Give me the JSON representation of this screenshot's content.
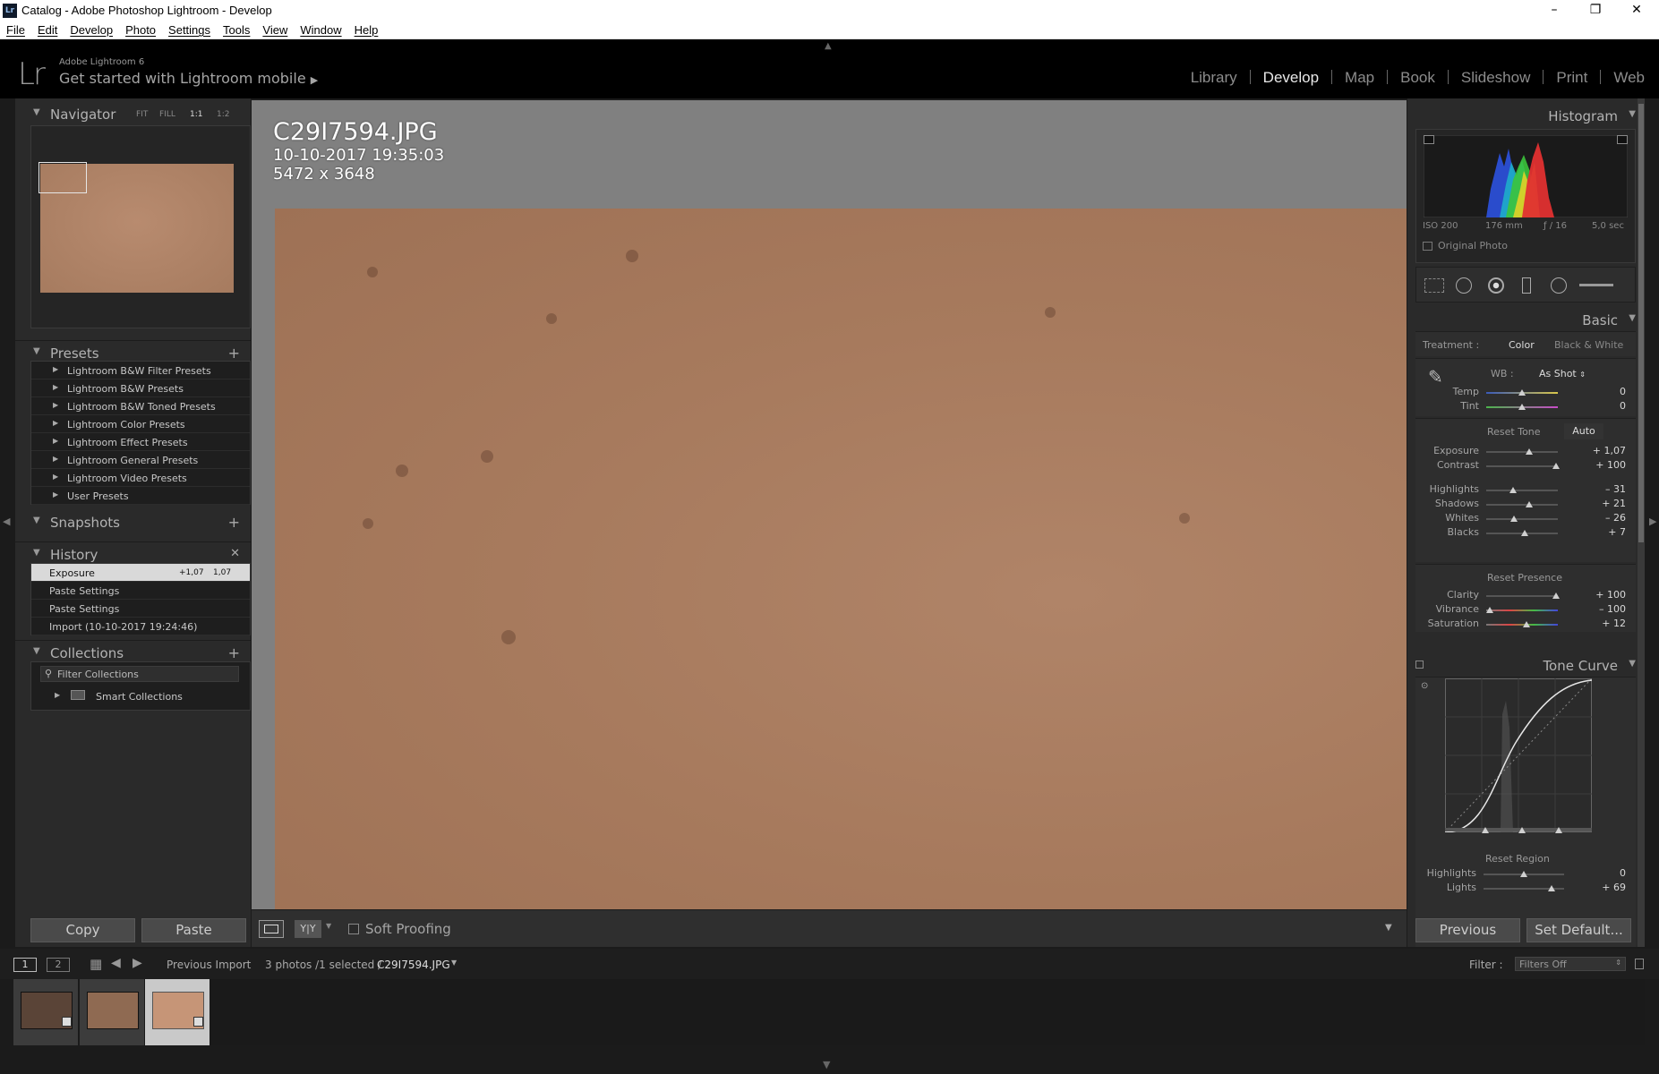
{
  "window": {
    "title": "Catalog - Adobe Photoshop Lightroom - Develop",
    "app_icon": "Lr"
  },
  "menu": [
    "File",
    "Edit",
    "Develop",
    "Photo",
    "Settings",
    "Tools",
    "View",
    "Window",
    "Help"
  ],
  "identity": {
    "version": "Adobe Lightroom 6",
    "mobile": "Get started with Lightroom mobile"
  },
  "modules": [
    "Library",
    "Develop",
    "Map",
    "Book",
    "Slideshow",
    "Print",
    "Web"
  ],
  "active_module": "Develop",
  "navigator": {
    "title": "Navigator",
    "zoom": [
      "FIT",
      "FILL",
      "1:1",
      "1:2"
    ],
    "active_zoom": "1:1"
  },
  "presets": {
    "title": "Presets",
    "items": [
      "Lightroom B&W Filter Presets",
      "Lightroom B&W Presets",
      "Lightroom B&W Toned Presets",
      "Lightroom Color Presets",
      "Lightroom Effect Presets",
      "Lightroom General Presets",
      "Lightroom Video Presets",
      "User Presets"
    ]
  },
  "snapshots": {
    "title": "Snapshots"
  },
  "history": {
    "title": "History",
    "items": [
      {
        "label": "Exposure",
        "v1": "+1,07",
        "v2": "1,07"
      },
      {
        "label": "Paste Settings",
        "v1": "",
        "v2": ""
      },
      {
        "label": "Paste Settings",
        "v1": "",
        "v2": ""
      },
      {
        "label": "Import (10-10-2017 19:24:46)",
        "v1": "",
        "v2": ""
      }
    ]
  },
  "collections": {
    "title": "Collections",
    "filter": "Filter Collections",
    "smart": "Smart Collections"
  },
  "left_buttons": {
    "copy": "Copy",
    "paste": "Paste"
  },
  "image": {
    "name": "C29I7594.JPG",
    "date": "10-10-2017 19:35:03",
    "size": "5472 x 3648"
  },
  "toolbar": {
    "soft_proofing": "Soft Proofing",
    "view_mode": "Y|Y"
  },
  "histogram": {
    "title": "Histogram",
    "iso": "ISO 200",
    "focal": "176 mm",
    "aperture": "ƒ / 16",
    "shutter": "5,0 sec",
    "original_photo": "Original Photo"
  },
  "basic": {
    "title": "Basic",
    "treatment_label": "Treatment :",
    "treatment_color": "Color",
    "treatment_bw": "Black & White",
    "wb_label": "WB :",
    "wb_value": "As Shot",
    "reset_tone": "Reset Tone",
    "auto": "Auto",
    "reset_presence": "Reset Presence",
    "sliders": [
      {
        "label": "Temp",
        "value": "0",
        "pos": 0.5
      },
      {
        "label": "Tint",
        "value": "0",
        "pos": 0.5
      },
      {
        "label": "Exposure",
        "value": "+ 1,07",
        "pos": 0.6
      },
      {
        "label": "Contrast",
        "value": "+ 100",
        "pos": 0.97
      },
      {
        "label": "Highlights",
        "value": "– 31",
        "pos": 0.37
      },
      {
        "label": "Shadows",
        "value": "+ 21",
        "pos": 0.6
      },
      {
        "label": "Whites",
        "value": "– 26",
        "pos": 0.39
      },
      {
        "label": "Blacks",
        "value": "+ 7",
        "pos": 0.54
      },
      {
        "label": "Clarity",
        "value": "+ 100",
        "pos": 0.97
      },
      {
        "label": "Vibrance",
        "value": "– 100",
        "pos": 0.05
      },
      {
        "label": "Saturation",
        "value": "+ 12",
        "pos": 0.56
      }
    ]
  },
  "tone_curve": {
    "title": "Tone Curve",
    "reset_region": "Reset Region",
    "sliders": [
      {
        "label": "Highlights",
        "value": "0",
        "pos": 0.5
      },
      {
        "label": "Lights",
        "value": "+ 69",
        "pos": 0.84
      }
    ]
  },
  "right_buttons": {
    "previous": "Previous",
    "set_default": "Set Default..."
  },
  "filmstrip": {
    "screen1": "1",
    "screen2": "2",
    "source": "Previous Import",
    "count": "3 photos /1 selected /",
    "filename": "C29I7594.JPG",
    "filter_label": "Filter :",
    "filter_value": "Filters Off"
  },
  "colors": {
    "photo": "#a87a5e",
    "panel": "#2a2a2a",
    "center_bg": "#808080"
  }
}
